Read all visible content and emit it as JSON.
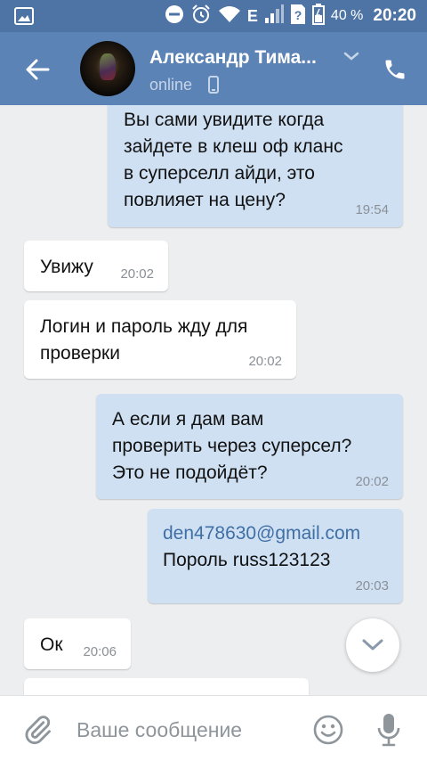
{
  "status_bar": {
    "network": "E",
    "battery": "40 %",
    "time": "20:20",
    "icons": [
      "gallery-icon",
      "dnd-icon",
      "alarm-icon",
      "wifi-icon",
      "signal-icon",
      "no-sim-icon",
      "battery-icon"
    ]
  },
  "header": {
    "contact_name": "Александр Тима...",
    "status": "online",
    "icons": [
      "back-arrow-icon",
      "chevron-down-icon",
      "mobile-icon",
      "phone-icon"
    ]
  },
  "messages": [
    {
      "direction": "out",
      "text": "Вы сами увидите когда\nзайдете в клеш оф кланс\nв суперселл айди, это\nповлияет на цену?",
      "time": "19:54"
    },
    {
      "direction": "in",
      "text": "Увижу",
      "time": "20:02"
    },
    {
      "direction": "in",
      "text": "Логин и пароль жду для\nпроверки",
      "time": "20:02"
    },
    {
      "direction": "out",
      "text": "А если я дам вам\nпроверить через суперсел?\nЭто не подойдёт?",
      "time": "20:02"
    },
    {
      "direction": "out",
      "link": "den478630@gmail.com",
      "text": "Пороль russ123123",
      "time": "20:03"
    },
    {
      "direction": "in",
      "text": "Ок",
      "time": "20:06"
    }
  ],
  "composer": {
    "placeholder": "Ваше сообщение",
    "icons": [
      "paperclip-icon",
      "emoji-icon",
      "microphone-icon"
    ]
  },
  "colors": {
    "header": "#5b83b6",
    "status_bar": "#4d74a5",
    "background": "#edeef0",
    "outgoing_bubble": "#cfe0f3",
    "incoming_bubble": "#ffffff",
    "link": "#3f6fa5"
  }
}
